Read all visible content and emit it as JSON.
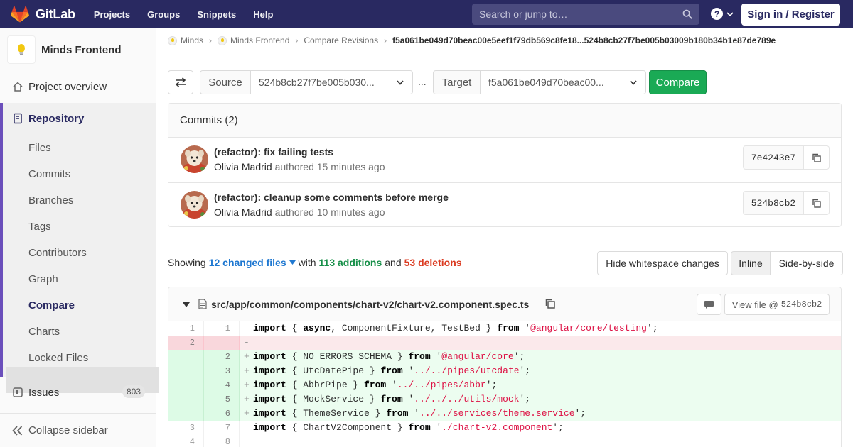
{
  "navbar": {
    "brand": "GitLab",
    "links": [
      "Projects",
      "Groups",
      "Snippets",
      "Help"
    ],
    "search_placeholder": "Search or jump to…",
    "help_glyph": "?",
    "signin_label": "Sign in / Register"
  },
  "sidebar": {
    "project_name": "Minds Frontend",
    "overview": "Project overview",
    "repository": "Repository",
    "sub_items": [
      "Files",
      "Commits",
      "Branches",
      "Tags",
      "Contributors",
      "Graph",
      "Compare",
      "Charts",
      "Locked Files"
    ],
    "issues_label": "Issues",
    "issues_count": "803",
    "collapse": "Collapse sidebar"
  },
  "breadcrumb": {
    "items": [
      "Minds",
      "Minds Frontend",
      "Compare Revisions"
    ],
    "current": "f5a061be049d70beac00e5eef1f79db569c8fe18...524b8cb27f7be005b03009b180b34b1e87de789e"
  },
  "compare": {
    "source_label": "Source",
    "source_value": "524b8cb27f7be005b030...",
    "dots": "...",
    "target_label": "Target",
    "target_value": "f5a061be049d70beac00...",
    "button": "Compare"
  },
  "commits": {
    "header": "Commits (2)",
    "items": [
      {
        "title": "(refactor): fix failing tests",
        "author": "Olivia Madrid",
        "verb": "authored",
        "time": "15 minutes ago",
        "sha": "7e4243e7"
      },
      {
        "title": "(refactor): cleanup some comments before merge",
        "author": "Olivia Madrid",
        "verb": "authored",
        "time": "10 minutes ago",
        "sha": "524b8cb2"
      }
    ]
  },
  "stats": {
    "showing": "Showing",
    "files": "12 changed files",
    "with": "with",
    "additions": "113 additions",
    "and": "and",
    "deletions": "53 deletions"
  },
  "view": {
    "whitespace": "Hide whitespace changes",
    "inline": "Inline",
    "side": "Side-by-side"
  },
  "diff": {
    "file_path": "src/app/common/components/chart-v2/chart-v2.component.spec.ts",
    "view_file_label": "View file @",
    "view_file_sha": "524b8cb2",
    "lines": [
      {
        "type": "context",
        "old": "1",
        "new": "1",
        "marker": "",
        "parts": [
          [
            "kw",
            "import"
          ],
          [
            "",
            "{ "
          ],
          [
            "kw",
            "async"
          ],
          [
            "",
            ", ComponentFixture, TestBed } "
          ],
          [
            "kw",
            "from"
          ],
          [
            "",
            " '"
          ],
          [
            "str",
            "@angular/core/testing"
          ],
          [
            "",
            "';"
          ]
        ]
      },
      {
        "type": "del",
        "old": "2",
        "new": "",
        "marker": "-",
        "parts": []
      },
      {
        "type": "add",
        "old": "",
        "new": "2",
        "marker": "+",
        "parts": [
          [
            "kw",
            "import"
          ],
          [
            "",
            "{ NO_ERRORS_SCHEMA } "
          ],
          [
            "kw",
            "from"
          ],
          [
            "",
            " '"
          ],
          [
            "str",
            "@angular/core"
          ],
          [
            "",
            "';"
          ]
        ]
      },
      {
        "type": "add",
        "old": "",
        "new": "3",
        "marker": "+",
        "parts": [
          [
            "kw",
            "import"
          ],
          [
            "",
            "{ UtcDatePipe } "
          ],
          [
            "kw",
            "from"
          ],
          [
            "",
            " '"
          ],
          [
            "str",
            "../../pipes/utcdate"
          ],
          [
            "",
            "';"
          ]
        ]
      },
      {
        "type": "add",
        "old": "",
        "new": "4",
        "marker": "+",
        "parts": [
          [
            "kw",
            "import"
          ],
          [
            "",
            "{ AbbrPipe } "
          ],
          [
            "kw",
            "from"
          ],
          [
            "",
            " '"
          ],
          [
            "str",
            "../../pipes/abbr"
          ],
          [
            "",
            "';"
          ]
        ]
      },
      {
        "type": "add",
        "old": "",
        "new": "5",
        "marker": "+",
        "parts": [
          [
            "kw",
            "import"
          ],
          [
            "",
            "{ MockService } "
          ],
          [
            "kw",
            "from"
          ],
          [
            "",
            " '"
          ],
          [
            "str",
            "../../../utils/mock"
          ],
          [
            "",
            "';"
          ]
        ]
      },
      {
        "type": "add",
        "old": "",
        "new": "6",
        "marker": "+",
        "parts": [
          [
            "kw",
            "import"
          ],
          [
            "",
            "{ ThemeService } "
          ],
          [
            "kw",
            "from"
          ],
          [
            "",
            " '"
          ],
          [
            "str",
            "../../services/theme.service"
          ],
          [
            "",
            "';"
          ]
        ]
      },
      {
        "type": "context",
        "old": "3",
        "new": "7",
        "marker": "",
        "parts": [
          [
            "kw",
            "import"
          ],
          [
            "",
            "{ ChartV2Component } "
          ],
          [
            "kw",
            "from"
          ],
          [
            "",
            " '"
          ],
          [
            "str",
            "./chart-v2.component"
          ],
          [
            "",
            "';"
          ]
        ]
      },
      {
        "type": "context",
        "old": "4",
        "new": "8",
        "marker": "",
        "parts": []
      }
    ]
  }
}
